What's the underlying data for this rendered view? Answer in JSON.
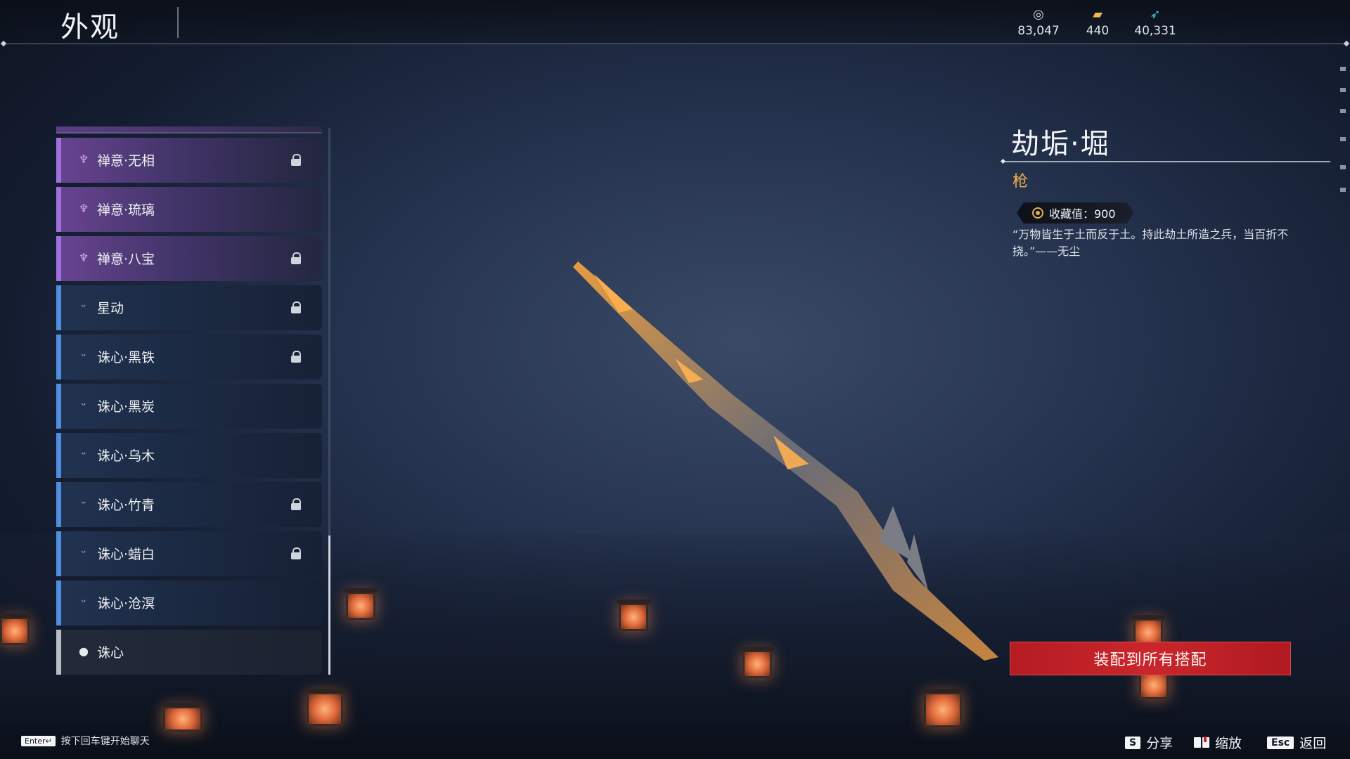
{
  "header": {
    "title": "外观",
    "currencies": [
      {
        "icon": "silver-coin-icon",
        "value": "83,047"
      },
      {
        "icon": "ticket-icon",
        "value": "440"
      },
      {
        "icon": "feather-icon",
        "value": "40,331"
      }
    ]
  },
  "skin_list": {
    "items": [
      {
        "label": "禅意·无相",
        "rarity": "purple",
        "locked": true
      },
      {
        "label": "禅意·琉璃",
        "rarity": "purple",
        "locked": false
      },
      {
        "label": "禅意·八宝",
        "rarity": "purple",
        "locked": true
      },
      {
        "label": "星动",
        "rarity": "blue",
        "locked": true
      },
      {
        "label": "诛心·黑铁",
        "rarity": "blue",
        "locked": true
      },
      {
        "label": "诛心·黑炭",
        "rarity": "blue",
        "locked": false
      },
      {
        "label": "诛心·乌木",
        "rarity": "blue",
        "locked": false
      },
      {
        "label": "诛心·竹青",
        "rarity": "blue",
        "locked": true
      },
      {
        "label": "诛心·蜡白",
        "rarity": "blue",
        "locked": true
      },
      {
        "label": "诛心·沧溟",
        "rarity": "blue",
        "locked": false
      },
      {
        "label": "诛心",
        "rarity": "white",
        "locked": false
      }
    ]
  },
  "detail": {
    "name": "劫垢·堀",
    "type": "枪",
    "collection_label": "收藏值：900",
    "description": "“万物皆生于土而反于土。持此劫土所造之兵，当百折不挠。”——无尘",
    "equip_button": "装配到所有搭配"
  },
  "footer": {
    "chat_key": "Enter↵",
    "chat_hint": "按下回车键开始聊天",
    "share_key": "S",
    "share_label": "分享",
    "zoom_label": "缩放",
    "back_key": "Esc",
    "back_label": "返回"
  },
  "colors": {
    "purple_accent": "#a070e0",
    "blue_accent": "#4f8de0",
    "equip_red": "#c9262c",
    "type_orange": "#f0b04a"
  }
}
